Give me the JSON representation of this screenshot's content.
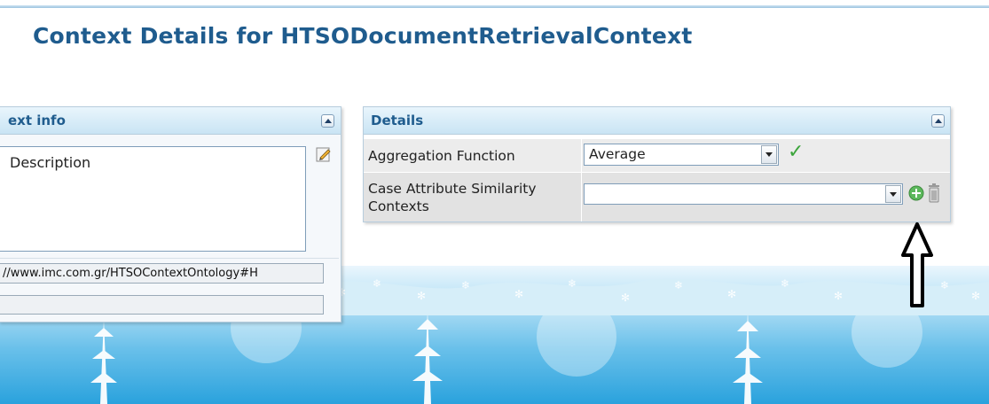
{
  "page": {
    "title": "Context Details for HTSODocumentRetrievalContext"
  },
  "left_panel": {
    "title": "ext info",
    "description_label": "Description",
    "uri": "//www.imc.com.gr/HTSOContextOntology#H",
    "second_field_value": ""
  },
  "details_panel": {
    "title": "Details",
    "rows": [
      {
        "label": "Aggregation Function",
        "value": "Average"
      },
      {
        "label": "Case Attribute Similarity Contexts",
        "value": ""
      }
    ]
  },
  "icons": {
    "collapse": "chevron-up-icon",
    "edit": "pencil-edit-icon",
    "confirm": "checkmark-icon",
    "add": "plus-circle-icon",
    "delete": "trash-icon",
    "annotation": "up-arrow-icon"
  },
  "colors": {
    "title": "#1f5c8e",
    "panel_header": "#c9e4f4",
    "check": "#3ca53c",
    "add": "#5cb85c"
  }
}
